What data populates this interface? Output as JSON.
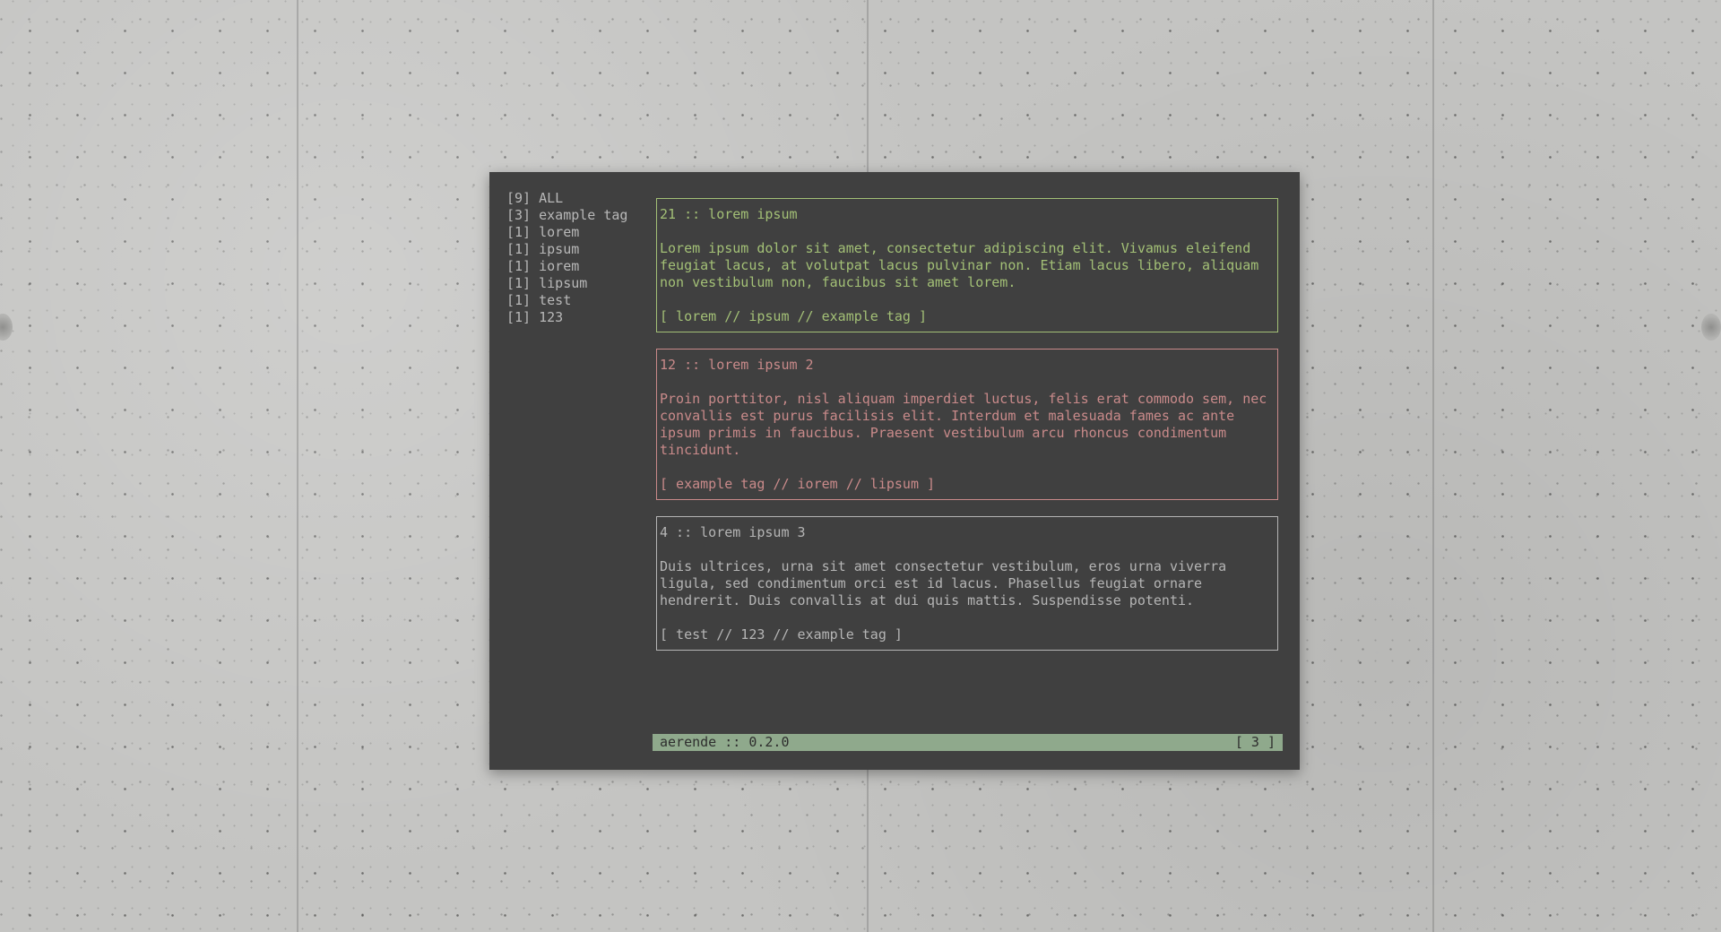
{
  "app": {
    "name": "aerende",
    "version": "0.2.0"
  },
  "colors": {
    "window_bg": "#404040",
    "selected_note": "#a3c076",
    "pink_note": "#c98a8a",
    "plain_note": "#b5b5b5",
    "statusbar_bg": "#8fa98c",
    "statusbar_text": "#2e2e2e"
  },
  "sidebar": {
    "tags": [
      {
        "count": "[9]",
        "name": "ALL"
      },
      {
        "count": "[3]",
        "name": "example tag"
      },
      {
        "count": "[1]",
        "name": "lorem"
      },
      {
        "count": "[1]",
        "name": "ipsum"
      },
      {
        "count": "[1]",
        "name": "iorem"
      },
      {
        "count": "[1]",
        "name": "lipsum"
      },
      {
        "count": "[1]",
        "name": "test"
      },
      {
        "count": "[1]",
        "name": "123"
      }
    ]
  },
  "notes": [
    {
      "title": "21 :: lorem ipsum",
      "body": "Lorem ipsum dolor sit amet, consectetur adipiscing elit. Vivamus eleifend\nfeugiat lacus, at volutpat lacus pulvinar non. Etiam lacus libero, aliquam\nnon vestibulum non, faucibus sit amet lorem.",
      "tags": "[ lorem // ipsum // example tag ]",
      "state": "selected"
    },
    {
      "title": "12 :: lorem ipsum 2",
      "body": "Proin porttitor, nisl aliquam imperdiet luctus, felis erat commodo sem, nec\nconvallis est purus facilisis elit. Interdum et malesuada fames ac ante\nipsum primis in faucibus. Praesent vestibulum arcu rhoncus condimentum\ntincidunt.",
      "tags": "[ example tag // iorem // lipsum ]",
      "state": "priority"
    },
    {
      "title": "4 :: lorem ipsum 3",
      "body": "Duis ultrices, urna sit amet consectetur vestibulum, eros urna viverra\nligula, sed condimentum orci est id lacus. Phasellus feugiat ornare\nhendrerit. Duis convallis at dui quis mattis. Suspendisse potenti.",
      "tags": "[ test // 123 // example tag ]",
      "state": "normal"
    }
  ],
  "statusbar": {
    "left": "aerende :: 0.2.0",
    "right": "[ 3 ]"
  }
}
